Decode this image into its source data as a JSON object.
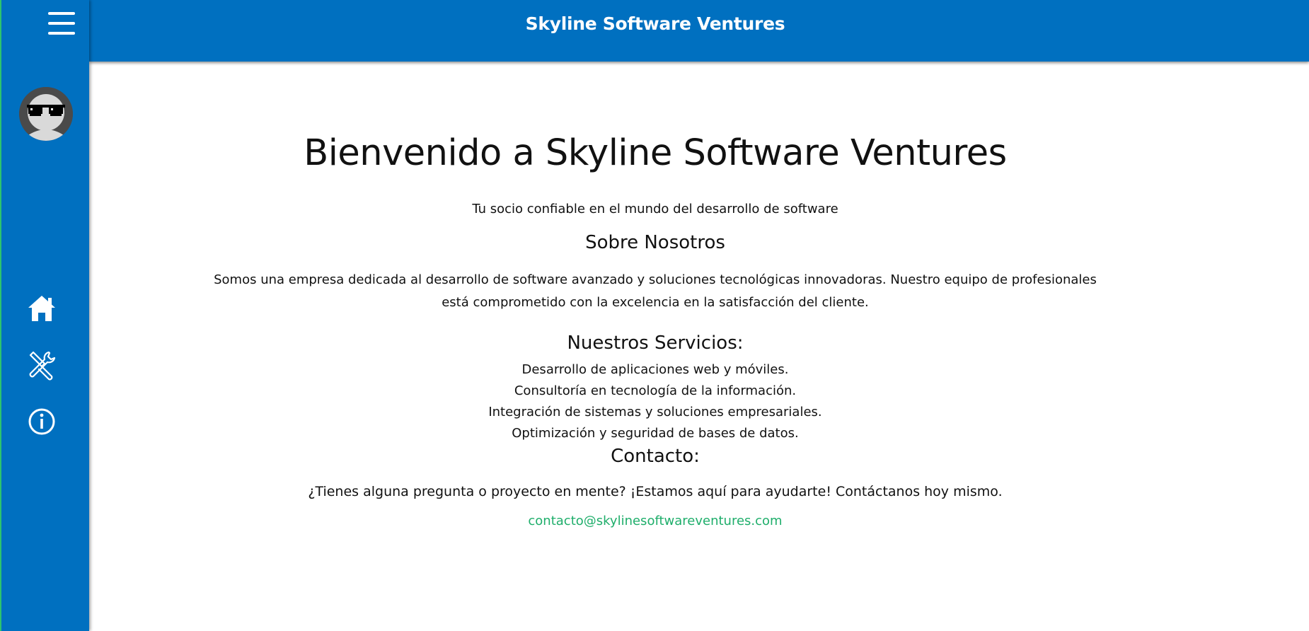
{
  "topbar": {
    "title": "Skyline Software Ventures"
  },
  "sidebar": {
    "items": [
      {
        "name": "home",
        "icon": "home-icon"
      },
      {
        "name": "services",
        "icon": "tools-icon"
      },
      {
        "name": "info",
        "icon": "info-icon"
      }
    ]
  },
  "main": {
    "heading": "Bienvenido a Skyline Software Ventures",
    "tagline": "Tu socio confiable en el mundo del desarrollo de software",
    "about": {
      "heading": "Sobre Nosotros",
      "text": "Somos una empresa dedicada al desarrollo de software avanzado y soluciones tecnológicas innovadoras. Nuestro equipo de profesionales está comprometido con la excelencia en la satisfacción del cliente."
    },
    "services": {
      "heading": "Nuestros Servicios:",
      "items": [
        "Desarrollo de aplicaciones web y móviles.",
        "Consultoría en tecnología de la información.",
        "Integración de sistemas y soluciones empresariales.",
        "Optimización y seguridad de bases de datos."
      ]
    },
    "contact": {
      "heading": "Contacto:",
      "text": "¿Tienes alguna pregunta o proyecto en mente? ¡Estamos aquí para ayudarte! Contáctanos hoy mismo.",
      "email": "contacto@skylinesoftwareventures.com"
    }
  },
  "colors": {
    "primary": "#0070c0",
    "accent": "#1fae6b",
    "text": "#111111"
  }
}
